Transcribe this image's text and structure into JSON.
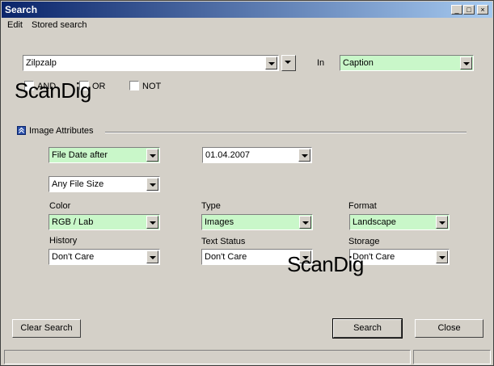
{
  "window": {
    "title": "Search"
  },
  "title_buttons": {
    "minimize": "_",
    "maximize": "□",
    "close": "×"
  },
  "menu": [
    "Edit",
    "Stored search"
  ],
  "search": {
    "query": "Zilpzalp",
    "in_label": "In",
    "in_value": "Caption",
    "logic": [
      "AND",
      "OR",
      "NOT"
    ]
  },
  "image_attributes": {
    "section_label": "Image Attributes",
    "date_mode": "File Date after",
    "date_value": "01.04.2007",
    "file_size": "Any File Size",
    "fields": [
      {
        "label": "Color",
        "value": "RGB / Lab"
      },
      {
        "label": "Type",
        "value": "Images"
      },
      {
        "label": "Format",
        "value": "Landscape"
      },
      {
        "label": "History",
        "value": "Don't Care"
      },
      {
        "label": "Text Status",
        "value": "Don't Care"
      },
      {
        "label": "Storage",
        "value": "Don't Care"
      }
    ]
  },
  "buttons": {
    "clear": "Clear Search",
    "search": "Search",
    "close": "Close"
  },
  "watermark": "ScanDig",
  "colors": {
    "highlight_field": "#c9f7c9",
    "titlebar_start": "#0a246a",
    "titlebar_end": "#a6caf0"
  }
}
